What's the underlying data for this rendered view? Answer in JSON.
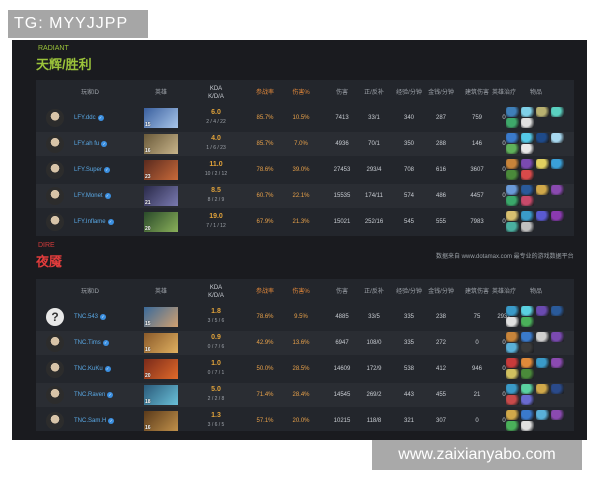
{
  "watermark_top": "TG: MYYJJPP",
  "watermark_bottom": "www.zaixianyabo.com",
  "source_note": "数据来自 www.dotamax.com 最专业的游戏数据平台",
  "columns": {
    "player": "玩家ID",
    "hero": "英雄",
    "kda_line1": "KDA",
    "kda_line2": "K/D/A",
    "participation": "参战率",
    "damage_pct": "伤害%",
    "damage": "伤害",
    "lh_dn": "正/反补",
    "xpm": "经验/分钟",
    "gpm": "金钱/分钟",
    "building": "建筑伤害",
    "healing": "英雄治疗",
    "items": "物品"
  },
  "radiant": {
    "sub": "RADIANT",
    "title": "天辉/胜利",
    "players": [
      {
        "name": "LFY.ddc",
        "level": "15",
        "kda": "6.0",
        "kdastr": "2 / 4 / 22",
        "participation": "85.7%",
        "damage_pct": "10.5%",
        "damage": "7413",
        "lhdn": "33/1",
        "xpm": "340",
        "gpm": "287",
        "building": "759",
        "healing": "0",
        "hero_colors": [
          "#3a5f9e",
          "#a8c6ea"
        ],
        "items": [
          "#3f7fb8",
          "#7fd0e8",
          "#b8b070",
          "#5ad0c0",
          "#3ea86a",
          "#e0e0e0"
        ]
      },
      {
        "name": "LFY.ah fu",
        "level": "16",
        "kda": "4.0",
        "kdastr": "1 / 6 / 23",
        "participation": "85.7%",
        "damage_pct": "7.0%",
        "damage": "4936",
        "lhdn": "70/1",
        "xpm": "350",
        "gpm": "288",
        "building": "146",
        "healing": "0",
        "hero_colors": [
          "#6a5a3a",
          "#c8b48a"
        ],
        "items": [
          "#3a7acb",
          "#54c8e6",
          "#1e4a8a",
          "#a8d8f0",
          "#5fb05a",
          "#e8e8e8"
        ]
      },
      {
        "name": "LFY.Super",
        "level": "23",
        "kda": "11.0",
        "kdastr": "10 / 2 / 12",
        "participation": "78.6%",
        "damage_pct": "39.0%",
        "damage": "27453",
        "lhdn": "293/4",
        "xpm": "708",
        "gpm": "616",
        "building": "3607",
        "healing": "0",
        "hero_colors": [
          "#5a2a1e",
          "#c86a3a"
        ],
        "items": [
          "#c8843a",
          "#7a4ab0",
          "#e0d060",
          "#3aa0d8",
          "#4a8a3a",
          "#d84a4a"
        ]
      },
      {
        "name": "LFY.Monet",
        "level": "21",
        "kda": "8.5",
        "kdastr": "8 / 2 / 9",
        "participation": "60.7%",
        "damage_pct": "22.1%",
        "damage": "15535",
        "lhdn": "174/11",
        "xpm": "574",
        "gpm": "486",
        "building": "4457",
        "healing": "0",
        "hero_colors": [
          "#2a2a4a",
          "#7a7ab0"
        ],
        "items": [
          "#6a9ad8",
          "#2a5a9a",
          "#d0a84a",
          "#8a4ab0",
          "#3aa86a",
          "#c84a6a"
        ]
      },
      {
        "name": "LFY.Inflame",
        "level": "20",
        "kda": "19.0",
        "kdastr": "7 / 1 / 12",
        "participation": "67.9%",
        "damage_pct": "21.3%",
        "damage": "15021",
        "lhdn": "252/16",
        "xpm": "545",
        "gpm": "555",
        "building": "7983",
        "healing": "0",
        "hero_colors": [
          "#2a4a2a",
          "#8ab05a"
        ],
        "items": [
          "#d8c070",
          "#3a9ac8",
          "#5a5ad0",
          "#8a3ab0",
          "#4ab0a0",
          "#c0c0c0"
        ]
      }
    ]
  },
  "dire": {
    "sub": "DIRE",
    "title": "夜魇",
    "players": [
      {
        "name": "TNC.543",
        "level": "15",
        "unknown_avatar": "?",
        "kda": "1.8",
        "kdastr": "3 / 5 / 6",
        "participation": "78.6%",
        "damage_pct": "9.5%",
        "damage": "4885",
        "lhdn": "33/5",
        "xpm": "335",
        "gpm": "238",
        "building": "75",
        "healing": "2932",
        "hero_colors": [
          "#3a6a9a",
          "#d0a070"
        ],
        "items": [
          "#3a9ac8",
          "#5ad0e0",
          "#6a4ab0",
          "#2a5a9a",
          "#e0e0e0",
          "#4ab05a"
        ]
      },
      {
        "name": "TNC.Tims",
        "level": "16",
        "kda": "0.9",
        "kdastr": "0 / 7 / 6",
        "participation": "42.9%",
        "damage_pct": "13.6%",
        "damage": "6947",
        "lhdn": "108/0",
        "xpm": "335",
        "gpm": "272",
        "building": "0",
        "healing": "0",
        "hero_colors": [
          "#8a5a2a",
          "#e0b060"
        ],
        "items": [
          "#c8843a",
          "#3a7acb",
          "#d0d0d0",
          "#7a4ab0",
          "#5ab0d8",
          "#3a3a3a"
        ]
      },
      {
        "name": "TNC.KuKu",
        "level": "20",
        "kda": "1.0",
        "kdastr": "0 / 7 / 1",
        "participation": "50.0%",
        "damage_pct": "28.5%",
        "damage": "14609",
        "lhdn": "172/9",
        "xpm": "538",
        "gpm": "412",
        "building": "946",
        "healing": "0",
        "hero_colors": [
          "#7a2a1a",
          "#e06a2a"
        ],
        "items": [
          "#c83a3a",
          "#e08a3a",
          "#3a9ac8",
          "#8a4ab0",
          "#d0c060",
          "#4a8a3a"
        ]
      },
      {
        "name": "TNC.Raven",
        "level": "18",
        "kda": "5.0",
        "kdastr": "2 / 2 / 8",
        "participation": "71.4%",
        "damage_pct": "28.4%",
        "damage": "14545",
        "lhdn": "269/2",
        "xpm": "443",
        "gpm": "455",
        "building": "21",
        "healing": "0",
        "hero_colors": [
          "#2a5a7a",
          "#6ac0d8"
        ],
        "items": [
          "#3a9ac8",
          "#5ad0a0",
          "#d0a84a",
          "#2a4a8a",
          "#c84a4a",
          "#6a6ad0"
        ]
      },
      {
        "name": "TNC.Sam.H",
        "level": "16",
        "kda": "1.3",
        "kdastr": "3 / 6 / 5",
        "participation": "57.1%",
        "damage_pct": "20.0%",
        "damage": "10215",
        "lhdn": "118/8",
        "xpm": "321",
        "gpm": "307",
        "building": "0",
        "healing": "0",
        "hero_colors": [
          "#5a3a1a",
          "#c0904a"
        ],
        "items": [
          "#d0a84a",
          "#3a7acb",
          "#5ab0d8",
          "#8a4ab0",
          "#4ab05a",
          "#e0e0e0"
        ]
      }
    ]
  }
}
